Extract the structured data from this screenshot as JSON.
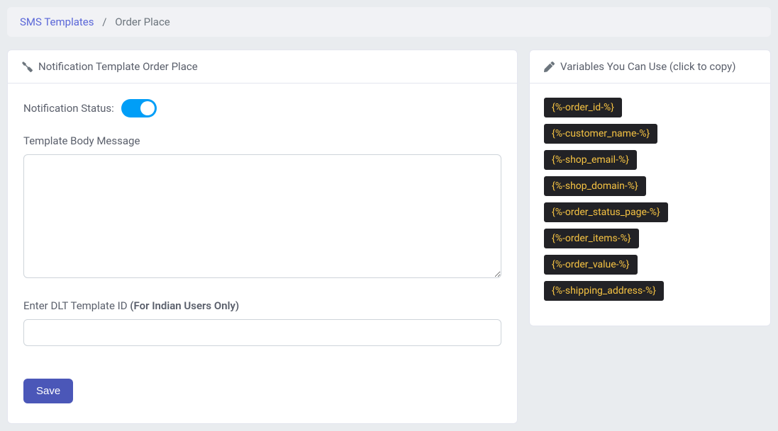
{
  "breadcrumb": {
    "parent": "SMS Templates",
    "current": "Order Place"
  },
  "leftCard": {
    "title": "Notification Template Order Place",
    "statusLabel": "Notification Status:",
    "bodyLabel": "Template Body Message",
    "bodyValue": "",
    "dltLabel": "Enter DLT Template ID ",
    "dltLabelStrong": "(For Indian Users Only)",
    "dltValue": "",
    "saveLabel": "Save"
  },
  "rightCard": {
    "title": "Variables You Can Use (click to copy)",
    "variables": [
      "{%-order_id-%}",
      "{%-customer_name-%}",
      "{%-shop_email-%}",
      "{%-shop_domain-%}",
      "{%-order_status_page-%}",
      "{%-order_items-%}",
      "{%-order_value-%}",
      "{%-shipping_address-%}"
    ]
  }
}
